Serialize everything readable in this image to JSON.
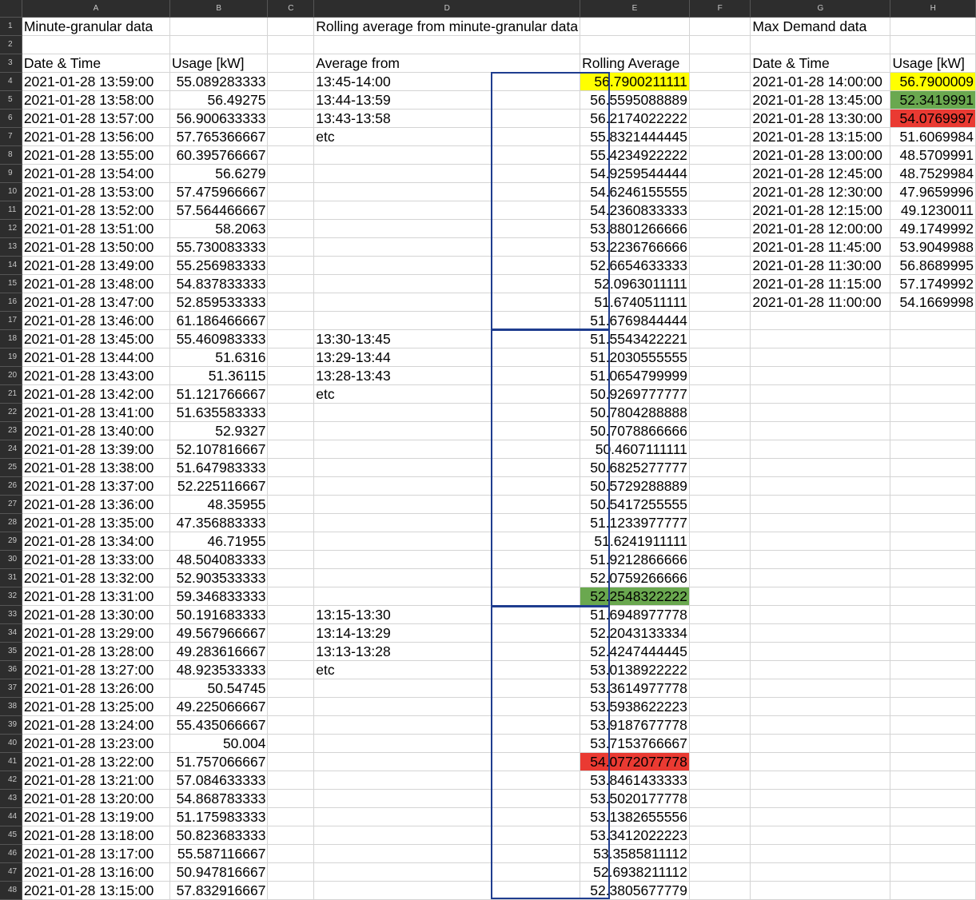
{
  "column_headers": [
    "A",
    "B",
    "C",
    "D",
    "E",
    "F",
    "G",
    "H"
  ],
  "row_numbers": [
    "1",
    "2",
    "3",
    "4",
    "5",
    "6",
    "7",
    "8",
    "9",
    "10",
    "11",
    "12",
    "13",
    "14",
    "15",
    "16",
    "17",
    "18",
    "19",
    "20",
    "21",
    "22",
    "23",
    "24",
    "25",
    "26",
    "27",
    "28",
    "29",
    "30",
    "31",
    "32",
    "33",
    "34",
    "35",
    "36",
    "37",
    "38",
    "39",
    "40",
    "41",
    "42",
    "43",
    "44",
    "45",
    "46",
    "47",
    "48"
  ],
  "colors": {
    "yellow": "#ffff00",
    "green": "#6aa84f",
    "red": "#ea3a32",
    "block_border": "#1f3d8f"
  },
  "rows": [
    [
      "Minute-granular data",
      "",
      "",
      "Rolling average from minute-granular data",
      "",
      "",
      "Max Demand data",
      ""
    ],
    [
      "",
      "",
      "",
      "",
      "",
      "",
      "",
      ""
    ],
    [
      "Date & Time",
      "Usage [kW]",
      "",
      "Average from",
      "Rolling Average",
      "",
      "Date & Time",
      "Usage [kW]"
    ],
    [
      "2021-01-28 13:59:00",
      "55.089283333",
      "",
      "13:45-14:00",
      "56.7900211111",
      "",
      "2021-01-28 14:00:00",
      "56.7900009"
    ],
    [
      "2021-01-28 13:58:00",
      "56.49275",
      "",
      "13:44-13:59",
      "56.5595088889",
      "",
      "2021-01-28 13:45:00",
      "52.3419991"
    ],
    [
      "2021-01-28 13:57:00",
      "56.900633333",
      "",
      "13:43-13:58",
      "56.2174022222",
      "",
      "2021-01-28 13:30:00",
      "54.0769997"
    ],
    [
      "2021-01-28 13:56:00",
      "57.765366667",
      "",
      "etc",
      "55.8321444445",
      "",
      "2021-01-28 13:15:00",
      "51.6069984"
    ],
    [
      "2021-01-28 13:55:00",
      "60.395766667",
      "",
      "",
      "55.4234922222",
      "",
      "2021-01-28 13:00:00",
      "48.5709991"
    ],
    [
      "2021-01-28 13:54:00",
      "56.6279",
      "",
      "",
      "54.9259544444",
      "",
      "2021-01-28 12:45:00",
      "48.7529984"
    ],
    [
      "2021-01-28 13:53:00",
      "57.475966667",
      "",
      "",
      "54.6246155555",
      "",
      "2021-01-28 12:30:00",
      "47.9659996"
    ],
    [
      "2021-01-28 13:52:00",
      "57.564466667",
      "",
      "",
      "54.2360833333",
      "",
      "2021-01-28 12:15:00",
      "49.1230011"
    ],
    [
      "2021-01-28 13:51:00",
      "58.2063",
      "",
      "",
      "53.8801266666",
      "",
      "2021-01-28 12:00:00",
      "49.1749992"
    ],
    [
      "2021-01-28 13:50:00",
      "55.730083333",
      "",
      "",
      "53.2236766666",
      "",
      "2021-01-28 11:45:00",
      "53.9049988"
    ],
    [
      "2021-01-28 13:49:00",
      "55.256983333",
      "",
      "",
      "52.6654633333",
      "",
      "2021-01-28 11:30:00",
      "56.8689995"
    ],
    [
      "2021-01-28 13:48:00",
      "54.837833333",
      "",
      "",
      "52.0963011111",
      "",
      "2021-01-28 11:15:00",
      "57.1749992"
    ],
    [
      "2021-01-28 13:47:00",
      "52.859533333",
      "",
      "",
      "51.6740511111",
      "",
      "2021-01-28 11:00:00",
      "54.1669998"
    ],
    [
      "2021-01-28 13:46:00",
      "61.186466667",
      "",
      "",
      "51.6769844444",
      "",
      "",
      ""
    ],
    [
      "2021-01-28 13:45:00",
      "55.460983333",
      "",
      "13:30-13:45",
      "51.5543422221",
      "",
      "",
      ""
    ],
    [
      "2021-01-28 13:44:00",
      "51.6316",
      "",
      "13:29-13:44",
      "51.2030555555",
      "",
      "",
      ""
    ],
    [
      "2021-01-28 13:43:00",
      "51.36115",
      "",
      "13:28-13:43",
      "51.0654799999",
      "",
      "",
      ""
    ],
    [
      "2021-01-28 13:42:00",
      "51.121766667",
      "",
      "etc",
      "50.9269777777",
      "",
      "",
      ""
    ],
    [
      "2021-01-28 13:41:00",
      "51.635583333",
      "",
      "",
      "50.7804288888",
      "",
      "",
      ""
    ],
    [
      "2021-01-28 13:40:00",
      "52.9327",
      "",
      "",
      "50.7078866666",
      "",
      "",
      ""
    ],
    [
      "2021-01-28 13:39:00",
      "52.107816667",
      "",
      "",
      "50.4607111111",
      "",
      "",
      ""
    ],
    [
      "2021-01-28 13:38:00",
      "51.647983333",
      "",
      "",
      "50.6825277777",
      "",
      "",
      ""
    ],
    [
      "2021-01-28 13:37:00",
      "52.225116667",
      "",
      "",
      "50.5729288889",
      "",
      "",
      ""
    ],
    [
      "2021-01-28 13:36:00",
      "48.35955",
      "",
      "",
      "50.5417255555",
      "",
      "",
      ""
    ],
    [
      "2021-01-28 13:35:00",
      "47.356883333",
      "",
      "",
      "51.1233977777",
      "",
      "",
      ""
    ],
    [
      "2021-01-28 13:34:00",
      "46.71955",
      "",
      "",
      "51.6241911111",
      "",
      "",
      ""
    ],
    [
      "2021-01-28 13:33:00",
      "48.504083333",
      "",
      "",
      "51.9212866666",
      "",
      "",
      ""
    ],
    [
      "2021-01-28 13:32:00",
      "52.903533333",
      "",
      "",
      "52.0759266666",
      "",
      "",
      ""
    ],
    [
      "2021-01-28 13:31:00",
      "59.346833333",
      "",
      "",
      "52.2548322222",
      "",
      "",
      ""
    ],
    [
      "2021-01-28 13:30:00",
      "50.191683333",
      "",
      "13:15-13:30",
      "51.6948977778",
      "",
      "",
      ""
    ],
    [
      "2021-01-28 13:29:00",
      "49.567966667",
      "",
      "13:14-13:29",
      "52.2043133334",
      "",
      "",
      ""
    ],
    [
      "2021-01-28 13:28:00",
      "49.283616667",
      "",
      "13:13-13:28",
      "52.4247444445",
      "",
      "",
      ""
    ],
    [
      "2021-01-28 13:27:00",
      "48.923533333",
      "",
      "etc",
      "53.0138922222",
      "",
      "",
      ""
    ],
    [
      "2021-01-28 13:26:00",
      "50.54745",
      "",
      "",
      "53.3614977778",
      "",
      "",
      ""
    ],
    [
      "2021-01-28 13:25:00",
      "49.225066667",
      "",
      "",
      "53.5938622223",
      "",
      "",
      ""
    ],
    [
      "2021-01-28 13:24:00",
      "55.435066667",
      "",
      "",
      "53.9187677778",
      "",
      "",
      ""
    ],
    [
      "2021-01-28 13:23:00",
      "50.004",
      "",
      "",
      "53.7153766667",
      "",
      "",
      ""
    ],
    [
      "2021-01-28 13:22:00",
      "51.757066667",
      "",
      "",
      "54.0772077778",
      "",
      "",
      ""
    ],
    [
      "2021-01-28 13:21:00",
      "57.084633333",
      "",
      "",
      "53.8461433333",
      "",
      "",
      ""
    ],
    [
      "2021-01-28 13:20:00",
      "54.868783333",
      "",
      "",
      "53.5020177778",
      "",
      "",
      ""
    ],
    [
      "2021-01-28 13:19:00",
      "51.175983333",
      "",
      "",
      "53.1382655556",
      "",
      "",
      ""
    ],
    [
      "2021-01-28 13:18:00",
      "50.823683333",
      "",
      "",
      "53.3412022223",
      "",
      "",
      ""
    ],
    [
      "2021-01-28 13:17:00",
      "55.587116667",
      "",
      "",
      "53.3585811112",
      "",
      "",
      ""
    ],
    [
      "2021-01-28 13:16:00",
      "50.947816667",
      "",
      "",
      "52.6938211112",
      "",
      "",
      ""
    ],
    [
      "2021-01-28 13:15:00",
      "57.832916667",
      "",
      "",
      "52.3805677779",
      "",
      "",
      ""
    ]
  ]
}
